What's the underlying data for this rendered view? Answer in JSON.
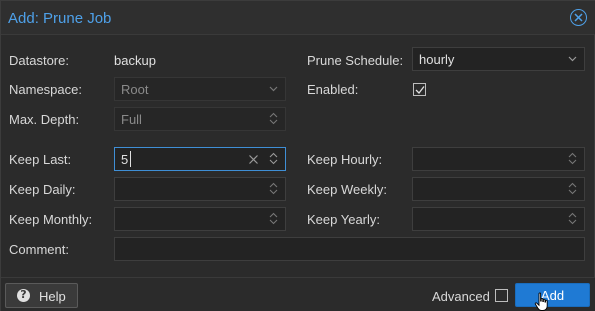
{
  "dialog": {
    "title": "Add: Prune Job"
  },
  "form": {
    "datastore": {
      "label": "Datastore:",
      "value": "backup"
    },
    "namespace": {
      "label": "Namespace:",
      "value": "Root"
    },
    "max_depth": {
      "label": "Max. Depth:",
      "value": "Full"
    },
    "prune_schedule": {
      "label": "Prune Schedule:",
      "value": "hourly"
    },
    "enabled": {
      "label": "Enabled:",
      "checked": true
    },
    "keep_last": {
      "label": "Keep Last:",
      "value": "5"
    },
    "keep_hourly": {
      "label": "Keep Hourly:",
      "value": ""
    },
    "keep_daily": {
      "label": "Keep Daily:",
      "value": ""
    },
    "keep_weekly": {
      "label": "Keep Weekly:",
      "value": ""
    },
    "keep_monthly": {
      "label": "Keep Monthly:",
      "value": ""
    },
    "keep_yearly": {
      "label": "Keep Yearly:",
      "value": ""
    },
    "comment": {
      "label": "Comment:",
      "value": ""
    }
  },
  "footer": {
    "help_label": "Help",
    "help_icon_glyph": "?",
    "advanced_label": "Advanced",
    "advanced_checked": false,
    "add_label": "Add"
  },
  "colors": {
    "accent": "#4ea0e8",
    "primary_button": "#1f7ad4",
    "background": "#2b2b2b"
  },
  "icons": {
    "close": "circle-x-icon",
    "combo": "chevron-down-icon",
    "spinner": "up-down-arrows-icon",
    "clear": "x-clear-icon",
    "help": "question-circle-icon",
    "check": "checkmark-icon"
  }
}
